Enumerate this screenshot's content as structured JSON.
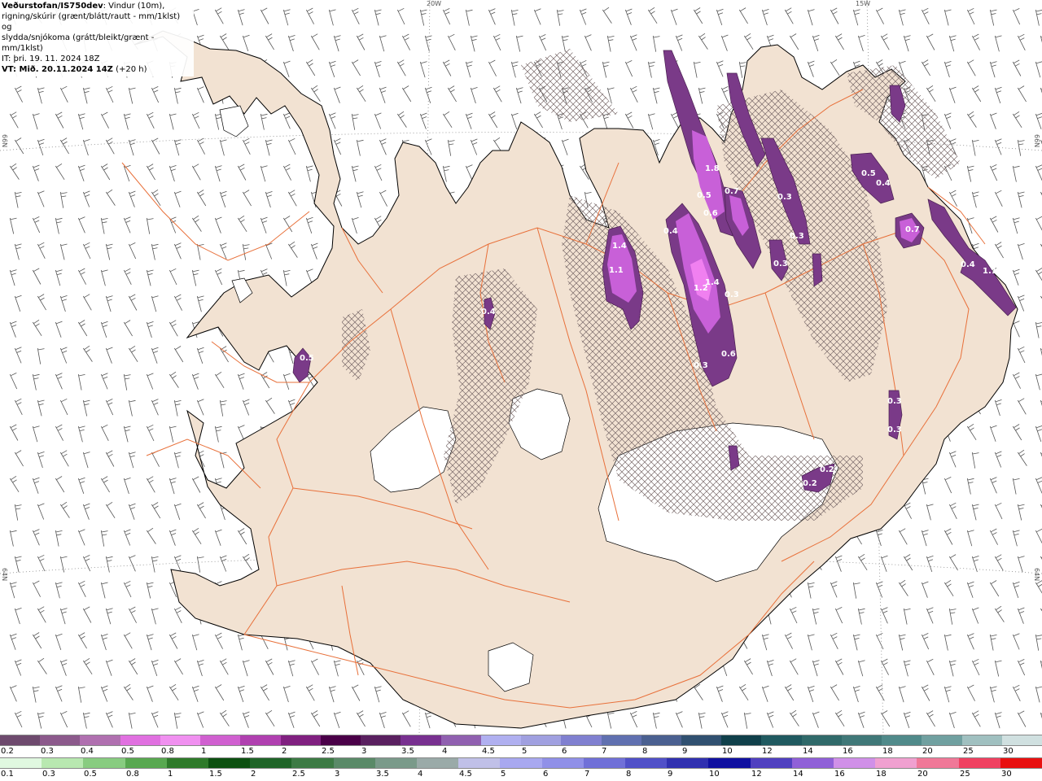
{
  "header": {
    "source": "Veðurstofan/IS750dev",
    "description_1": ": Vindur (10m),",
    "description_2": "rigning/skúrir (grænt/blátt/rautt - mm/1klst) og",
    "description_3": "slydda/snjókoma (grátt/bleikt/grænt - mm/1klst)",
    "issue_time": "IT: þri. 19. 11. 2024 18Z",
    "valid_label": "VT: Mið. 20.11.2024 14Z",
    "valid_offset": " (+20 h)"
  },
  "grid_labels": {
    "meridian_20w": "20W",
    "meridian_15w": "15W",
    "lat_66n_left": "66N",
    "lat_66n_right": "66N",
    "lat_64n_left": "64N",
    "lat_64n_right": "64N"
  },
  "precip_labels": [
    {
      "text": "0.5",
      "region": "west"
    },
    {
      "text": "0.4",
      "region": "north-central"
    },
    {
      "text": "1.4",
      "region": "north"
    },
    {
      "text": "1.1",
      "region": "north"
    },
    {
      "text": "0.4",
      "region": "north-east-band"
    },
    {
      "text": "0.5",
      "region": "north-east-band"
    },
    {
      "text": "0.6",
      "region": "north-east-band"
    },
    {
      "text": "0.7",
      "region": "north-east-band"
    },
    {
      "text": "1.8",
      "region": "north-east-band"
    },
    {
      "text": "1.2",
      "region": "central-band"
    },
    {
      "text": "1.4",
      "region": "central-band"
    },
    {
      "text": "0.3",
      "region": "central-band"
    },
    {
      "text": "0.6",
      "region": "central-band"
    },
    {
      "text": "0.3",
      "region": "central-band"
    },
    {
      "text": "0.3",
      "region": "east"
    },
    {
      "text": "0.3",
      "region": "east"
    },
    {
      "text": "0.3",
      "region": "east"
    },
    {
      "text": "0.5",
      "region": "north-east"
    },
    {
      "text": "0.4",
      "region": "north-east"
    },
    {
      "text": "0.7",
      "region": "east"
    },
    {
      "text": "0.4",
      "region": "east"
    },
    {
      "text": "1.1",
      "region": "east"
    },
    {
      "text": "0.3",
      "region": "south-east"
    },
    {
      "text": "0.3",
      "region": "south-east"
    },
    {
      "text": "0.2",
      "region": "south-east"
    },
    {
      "text": "0.2",
      "region": "south-east"
    }
  ],
  "legend": {
    "snow_values": [
      "0.2",
      "0.3",
      "0.4",
      "0.5",
      "0.8",
      "1",
      "1.5",
      "2",
      "2.5",
      "3",
      "3.5",
      "4",
      "4.5",
      "5",
      "6",
      "7",
      "8",
      "9",
      "10",
      "12",
      "14",
      "16",
      "18",
      "20",
      "25",
      "30"
    ],
    "snow_colors": [
      "#6e4a6e",
      "#8c5a8c",
      "#b070b0",
      "#e070e0",
      "#f090f0",
      "#d060d0",
      "#b040b0",
      "#802080",
      "#4a0048",
      "#5a2060",
      "#783090",
      "#9060b0",
      "#b0b0f0",
      "#a0a0e0",
      "#8080d0",
      "#6070b0",
      "#4a6090",
      "#305070",
      "#10404a",
      "#205a60",
      "#306a6a",
      "#407878",
      "#508a8a",
      "#70a0a0",
      "#a0c0c0",
      "#d0e0e0"
    ],
    "rain_values": [
      "0.1",
      "0.3",
      "0.5",
      "0.8",
      "1",
      "1.5",
      "2",
      "2.5",
      "3",
      "3.5",
      "4",
      "4.5",
      "5",
      "6",
      "7",
      "8",
      "9",
      "10",
      "12",
      "14",
      "16",
      "18",
      "20",
      "25",
      "30"
    ],
    "rain_colors": [
      "#e0f8e0",
      "#b8e8b0",
      "#88cc80",
      "#58a850",
      "#2e7a2a",
      "#0c5010",
      "#1f6428",
      "#3c7a44",
      "#5a8a68",
      "#7a9a8a",
      "#9aaaa8",
      "#c0c0e8",
      "#a8a8f0",
      "#9090e8",
      "#7070d8",
      "#5050c8",
      "#3030b0",
      "#1010a0",
      "#5040c0",
      "#9060d8",
      "#d090e8",
      "#f0a0d0",
      "#f07898",
      "#f04060",
      "#e81010"
    ]
  },
  "colors": {
    "land": "#f2e2d2",
    "ocean": "#ffffff",
    "coastline": "#000000",
    "roads": "#e8703a",
    "glacier": "#ffffff",
    "precip_light": "#7a3a88",
    "precip_mid": "#c860d8",
    "precip_heavy": "#f080f0",
    "hatch": "#7a6a6a",
    "wind_barb": "#555555"
  }
}
